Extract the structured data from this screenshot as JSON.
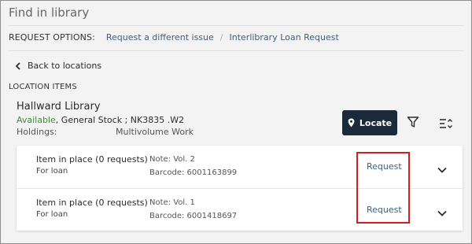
{
  "panel": {
    "title": "Find in library"
  },
  "request_options": {
    "label": "REQUEST OPTIONS:",
    "links": [
      "Request a different issue",
      "Interlibrary Loan Request"
    ]
  },
  "nav": {
    "back_label": "Back to locations"
  },
  "location_items": {
    "heading": "LOCATION ITEMS",
    "library": "Hallward Library",
    "availability": "Available",
    "location_detail": ", General Stock ; NK3835 .W2",
    "holdings_label": "Holdings:",
    "holdings_value": "Multivolume Work",
    "locate_label": "Locate"
  },
  "items": [
    {
      "status": "Item in place (0 requests)",
      "policy": "For loan",
      "note": "Note: Vol. 2",
      "barcode": "Barcode: 6001163899",
      "action": "Request"
    },
    {
      "status": "Item in place (0 requests)",
      "policy": "For loan",
      "note": "Note: Vol. 1",
      "barcode": "Barcode: 6001418697",
      "action": "Request"
    }
  ],
  "colors": {
    "available": "#3d8b37",
    "link": "#3f5f80",
    "locate_button": "#1b2a3a",
    "highlight_box": "#d11f1f"
  },
  "icons": [
    "chevron-left-icon",
    "map-pin-icon",
    "filter-icon",
    "sort-icon",
    "chevron-down-icon"
  ]
}
